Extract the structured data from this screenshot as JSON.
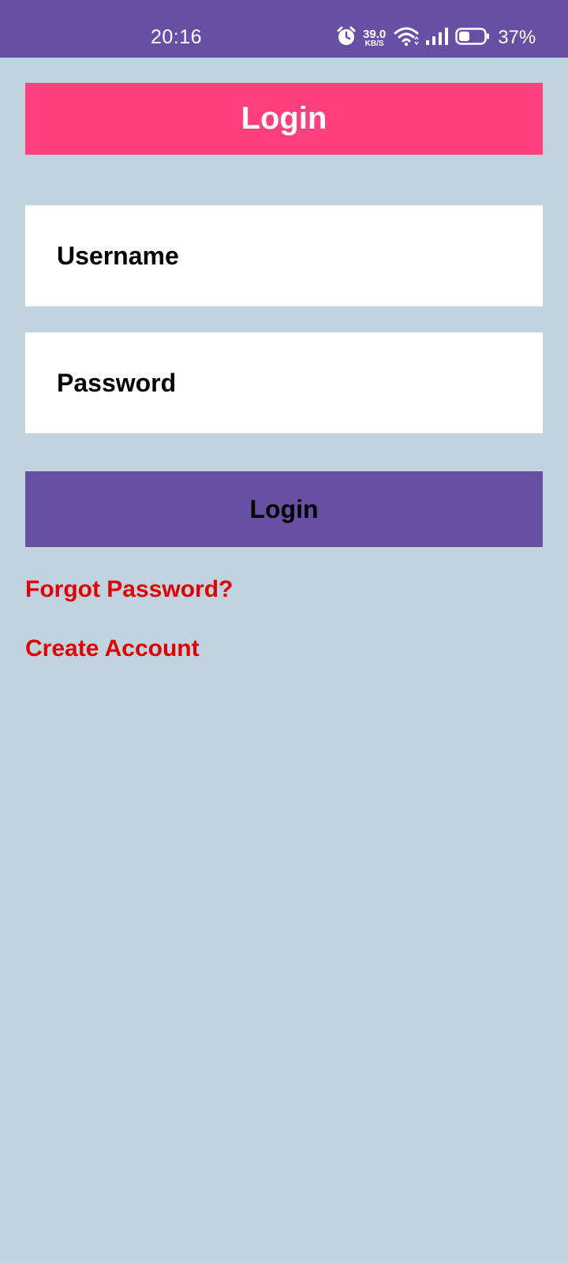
{
  "status_bar": {
    "time": "20:16",
    "net_speed_value": "39.0",
    "net_speed_unit": "KB/S",
    "battery_percent": "37%",
    "icons": [
      "alarm-icon",
      "wifi-icon",
      "signal-icon",
      "battery-icon"
    ]
  },
  "header": {
    "title": "Login"
  },
  "form": {
    "username_placeholder": "Username",
    "password_placeholder": "Password",
    "login_button_label": "Login"
  },
  "links": {
    "forgot_password": "Forgot Password?",
    "create_account": "Create Account"
  },
  "colors": {
    "status_bar": "#6750a4",
    "background": "#c0d4df",
    "banner": "#ff407d",
    "button": "#6750a4",
    "link": "#e30000"
  }
}
